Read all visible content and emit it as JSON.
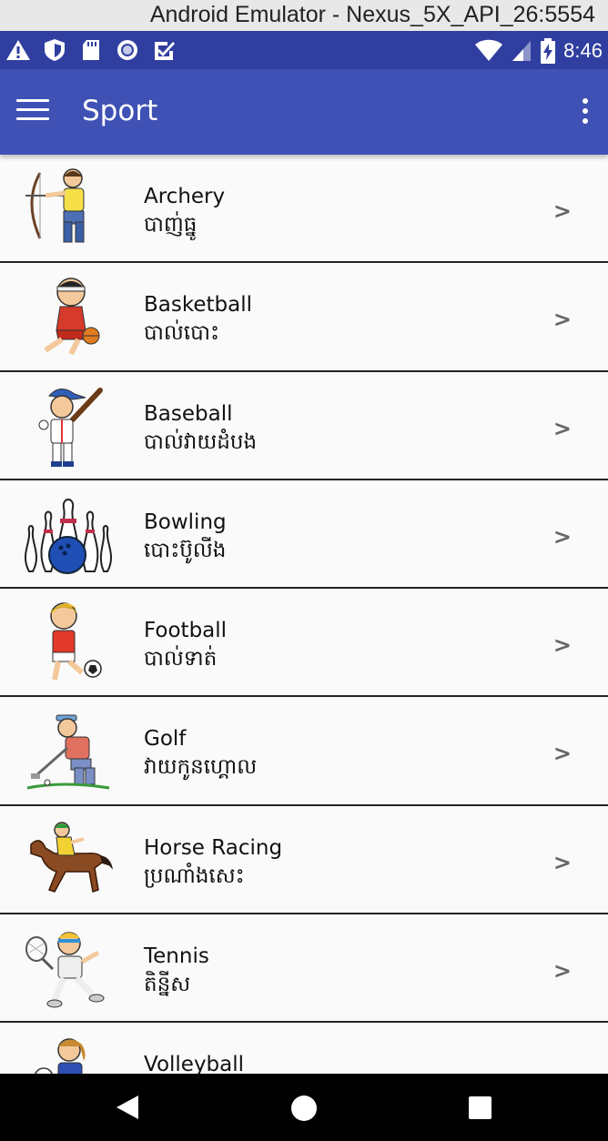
{
  "window": {
    "title": "Android Emulator - Nexus_5X_API_26:5554"
  },
  "status_bar": {
    "time": "8:46",
    "left_icons": [
      "warning-icon",
      "shield-icon",
      "sd-card-icon",
      "record-icon",
      "checkbox-icon"
    ],
    "right_icons": [
      "wifi-icon",
      "signal-icon",
      "battery-charging-icon"
    ]
  },
  "app_bar": {
    "title": "Sport",
    "color": "#3f51b5",
    "status_color": "#303f9f"
  },
  "sports": [
    {
      "name": "Archery",
      "khmer": "បាញ់ធ្នូ",
      "icon": "archer-icon",
      "chevron": ">"
    },
    {
      "name": "Basketball",
      "khmer": "បាល់បោះ",
      "icon": "basketball-player-icon",
      "chevron": ">"
    },
    {
      "name": "Baseball",
      "khmer": "បាល់វាយដំបង",
      "icon": "baseball-player-icon",
      "chevron": ">"
    },
    {
      "name": "Bowling",
      "khmer": "បោះប៊ូលីង",
      "icon": "bowling-icon",
      "chevron": ">"
    },
    {
      "name": "Football",
      "khmer": "បាល់ទាត់",
      "icon": "football-player-icon",
      "chevron": ">"
    },
    {
      "name": "Golf",
      "khmer": "វាយកូនហ្គោល",
      "icon": "golfer-icon",
      "chevron": ">"
    },
    {
      "name": "Horse Racing",
      "khmer": "ប្រណាំងសេះ",
      "icon": "horse-rider-icon",
      "chevron": ">"
    },
    {
      "name": "Tennis",
      "khmer": "តិន្នីស",
      "icon": "tennis-player-icon",
      "chevron": ">"
    },
    {
      "name": "Volleyball",
      "khmer": "",
      "icon": "volleyball-player-icon",
      "chevron": ""
    }
  ]
}
